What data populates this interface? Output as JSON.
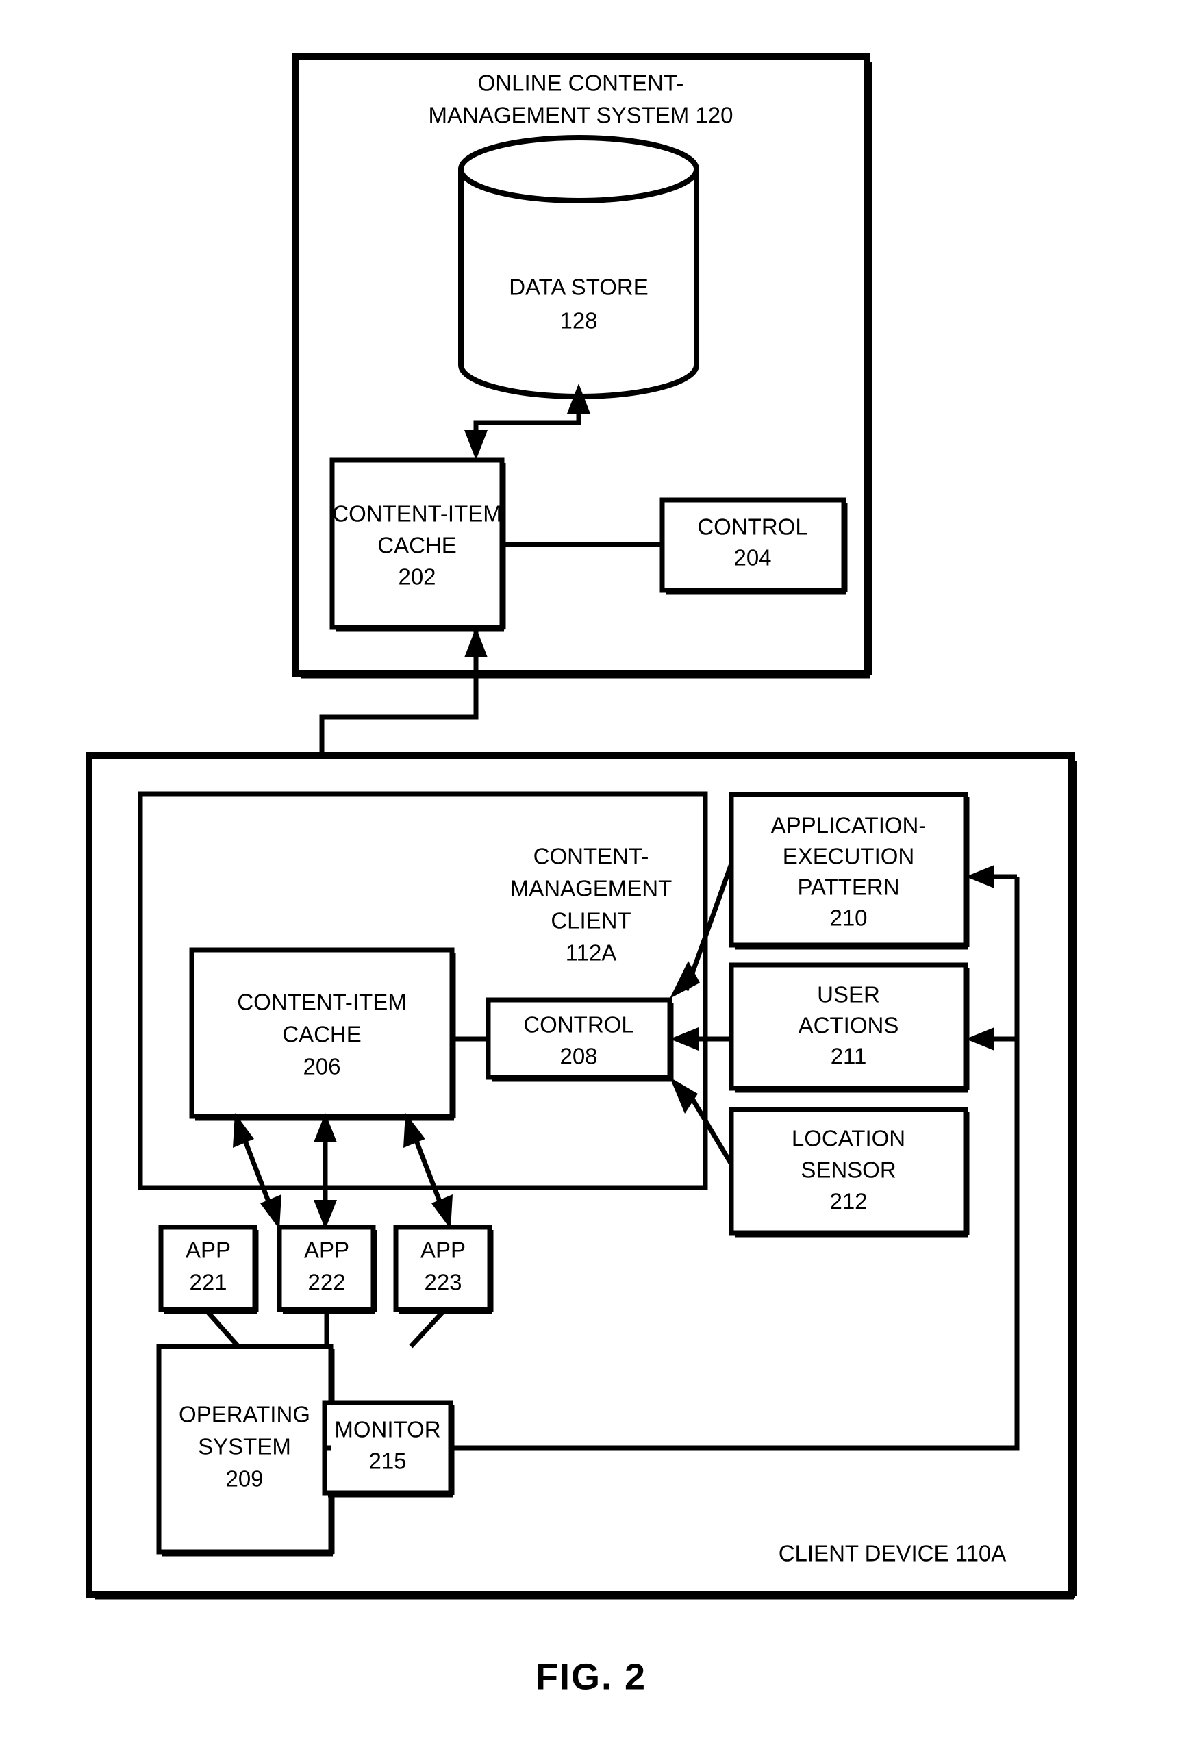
{
  "figure": {
    "caption": "FIG. 2",
    "type": "patent-block-diagram"
  },
  "server_system": {
    "title_line1": "ONLINE CONTENT-",
    "title_line2": "MANAGEMENT SYSTEM 120",
    "data_store": {
      "label": "DATA STORE",
      "ref": "128",
      "shape": "cylinder-icon"
    },
    "content_item_cache": {
      "line1": "CONTENT-ITEM",
      "line2": "CACHE",
      "ref": "202"
    },
    "control": {
      "label": "CONTROL",
      "ref": "204"
    }
  },
  "client_device": {
    "label": "CLIENT DEVICE 110A",
    "content_management_client": {
      "line1": "CONTENT-",
      "line2": "MANAGEMENT",
      "line3": "CLIENT",
      "ref": "112A"
    },
    "content_item_cache": {
      "line1": "CONTENT-ITEM",
      "line2": "CACHE",
      "ref": "206"
    },
    "control": {
      "label": "CONTROL",
      "ref": "208"
    },
    "application_execution_pattern": {
      "line1": "APPLICATION-",
      "line2": "EXECUTION",
      "line3": "PATTERN",
      "ref": "210"
    },
    "user_actions": {
      "line1": "USER",
      "line2": "ACTIONS",
      "ref": "211"
    },
    "location_sensor": {
      "line1": "LOCATION",
      "line2": "SENSOR",
      "ref": "212"
    },
    "apps": [
      {
        "label": "APP",
        "ref": "221"
      },
      {
        "label": "APP",
        "ref": "222"
      },
      {
        "label": "APP",
        "ref": "223"
      }
    ],
    "operating_system": {
      "line1": "OPERATING",
      "line2": "SYSTEM",
      "ref": "209"
    },
    "monitor": {
      "label": "MONITOR",
      "ref": "215"
    }
  },
  "colors": {
    "stroke": "#000000",
    "background": "#ffffff"
  }
}
